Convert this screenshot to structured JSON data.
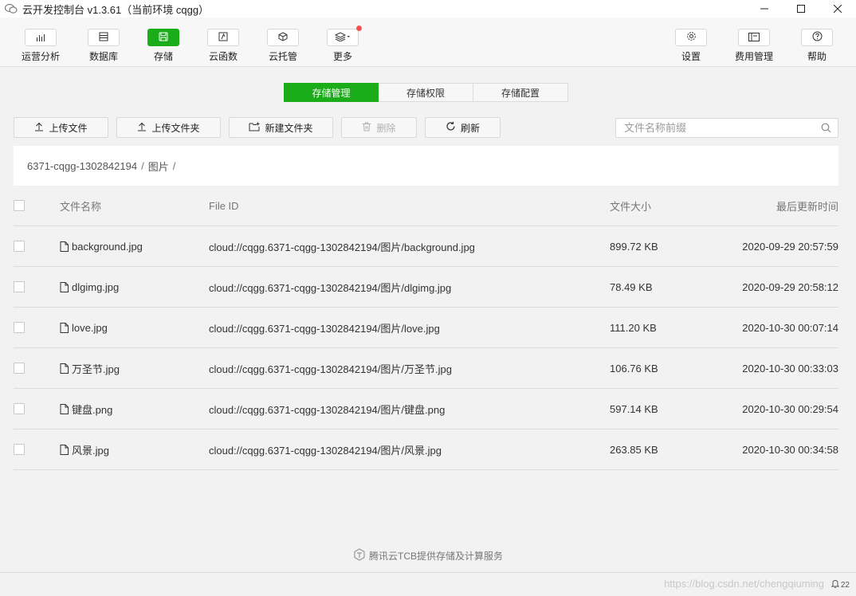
{
  "app": {
    "title": "云开发控制台 v1.3.61（当前环境 cqgg）"
  },
  "toolbar": {
    "left": [
      {
        "label": "运营分析",
        "icon": "bar-chart-icon"
      },
      {
        "label": "数据库",
        "icon": "database-icon"
      },
      {
        "label": "存储",
        "icon": "storage-icon",
        "active": true
      },
      {
        "label": "云函数",
        "icon": "function-icon"
      },
      {
        "label": "云托管",
        "icon": "cube-icon"
      },
      {
        "label": "更多",
        "icon": "layers-icon",
        "has_badge": true
      }
    ],
    "right": [
      {
        "label": "设置",
        "icon": "gear-icon"
      },
      {
        "label": "费用管理",
        "icon": "billing-icon"
      },
      {
        "label": "帮助",
        "icon": "help-icon"
      }
    ]
  },
  "tabs": [
    {
      "label": "存储管理",
      "active": true
    },
    {
      "label": "存储权限",
      "active": false
    },
    {
      "label": "存储配置",
      "active": false
    }
  ],
  "actions": {
    "upload_file": "上传文件",
    "upload_folder": "上传文件夹",
    "new_folder": "新建文件夹",
    "delete": "删除",
    "refresh": "刷新"
  },
  "search": {
    "placeholder": "文件名称前缀",
    "value": ""
  },
  "breadcrumb": {
    "root": "6371-cqgg-1302842194",
    "folder": "图片",
    "separator": "/"
  },
  "table": {
    "columns": {
      "name": "文件名称",
      "file_id": "File ID",
      "size": "文件大小",
      "updated": "最后更新时间"
    },
    "rows": [
      {
        "name": "background.jpg",
        "file_id": "cloud://cqgg.6371-cqgg-1302842194/图片/background.jpg",
        "size": "899.72 KB",
        "updated": "2020-09-29 20:57:59"
      },
      {
        "name": "dlgimg.jpg",
        "file_id": "cloud://cqgg.6371-cqgg-1302842194/图片/dlgimg.jpg",
        "size": "78.49 KB",
        "updated": "2020-09-29 20:58:12"
      },
      {
        "name": "love.jpg",
        "file_id": "cloud://cqgg.6371-cqgg-1302842194/图片/love.jpg",
        "size": "111.20 KB",
        "updated": "2020-10-30 00:07:14"
      },
      {
        "name": "万圣节.jpg",
        "file_id": "cloud://cqgg.6371-cqgg-1302842194/图片/万圣节.jpg",
        "size": "106.76 KB",
        "updated": "2020-10-30 00:33:03"
      },
      {
        "name": "键盘.png",
        "file_id": "cloud://cqgg.6371-cqgg-1302842194/图片/键盘.png",
        "size": "597.14 KB",
        "updated": "2020-10-30 00:29:54"
      },
      {
        "name": "风景.jpg",
        "file_id": "cloud://cqgg.6371-cqgg-1302842194/图片/风景.jpg",
        "size": "263.85 KB",
        "updated": "2020-10-30 00:34:58"
      }
    ]
  },
  "footer": {
    "note": "腾讯云TCB提供存储及计算服务",
    "watermark": "https://blog.csdn.net/chengqiuming",
    "notification_count": "22"
  },
  "colors": {
    "accent": "#1aad19",
    "badge": "#fa5151"
  }
}
